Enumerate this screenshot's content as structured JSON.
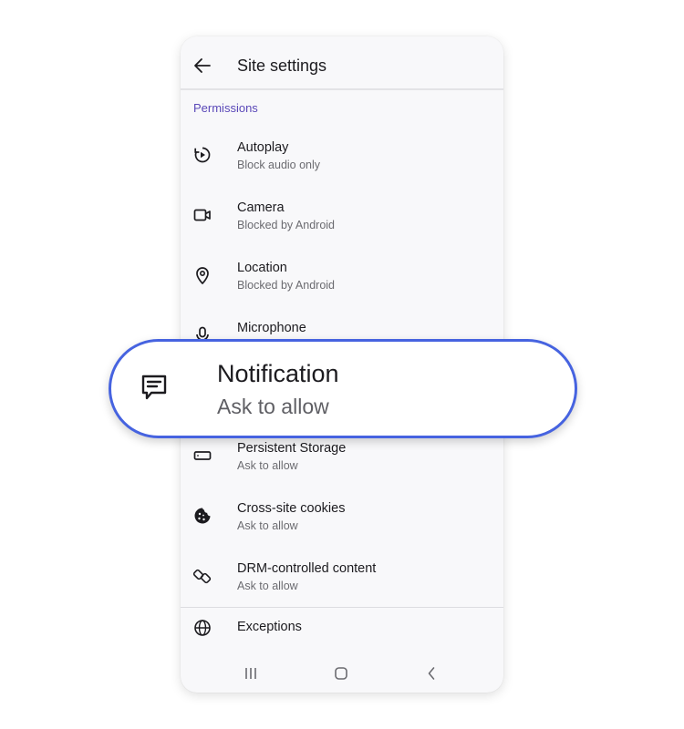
{
  "appbar": {
    "title": "Site settings"
  },
  "section": {
    "header": "Permissions"
  },
  "permissions": [
    {
      "label": "Autoplay",
      "sub": "Block audio only",
      "icon": "autoplay-icon"
    },
    {
      "label": "Camera",
      "sub": "Blocked by Android",
      "icon": "camera-icon"
    },
    {
      "label": "Location",
      "sub": "Blocked by Android",
      "icon": "location-icon"
    },
    {
      "label": "Microphone",
      "sub": "",
      "icon": "microphone-icon"
    },
    {
      "label": "Persistent Storage",
      "sub": "Ask to allow",
      "icon": "storage-icon"
    },
    {
      "label": "Cross-site cookies",
      "sub": "Ask to allow",
      "icon": "cookie-icon"
    },
    {
      "label": "DRM-controlled content",
      "sub": "Ask to allow",
      "icon": "drm-link-icon"
    }
  ],
  "exceptions": {
    "label": "Exceptions",
    "icon": "globe-icon"
  },
  "callout": {
    "label": "Notification",
    "sub": "Ask to allow",
    "icon": "message-icon"
  },
  "navbar": {
    "icons": [
      "recent-apps-icon",
      "home-icon",
      "back-icon"
    ]
  },
  "colors": {
    "accent": "#5a48b8",
    "callout_border": "#4663e0",
    "background": "#f8f8fa"
  }
}
